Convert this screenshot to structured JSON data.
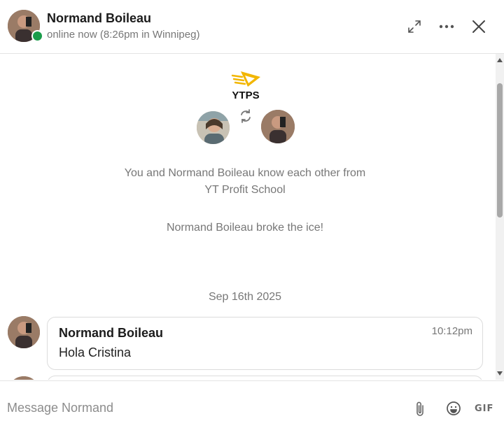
{
  "header": {
    "contact_name": "Normand Boileau",
    "status": "online now (8:26pm in Winnipeg)",
    "icons": [
      "expand-icon",
      "more-icon",
      "close-icon"
    ]
  },
  "intro": {
    "group_logo_text": "YTPS",
    "known_from_line1": "You and Normand Boileau know each other from",
    "known_from_line2": "YT Profit School",
    "icebreaker": "Normand Boileau broke the ice!"
  },
  "date_separator": "Sep 16th 2025",
  "messages": [
    {
      "sender": "Normand Boileau",
      "time": "10:12pm",
      "text": "Hola Cristina"
    }
  ],
  "composer": {
    "placeholder": "Message Normand",
    "gif_label": "GIF",
    "icons": [
      "attachment-icon",
      "emoji-icon"
    ]
  },
  "colors": {
    "online": "#1a9c4a",
    "logo_accent": "#f2b600",
    "secondary_text": "#777777"
  }
}
